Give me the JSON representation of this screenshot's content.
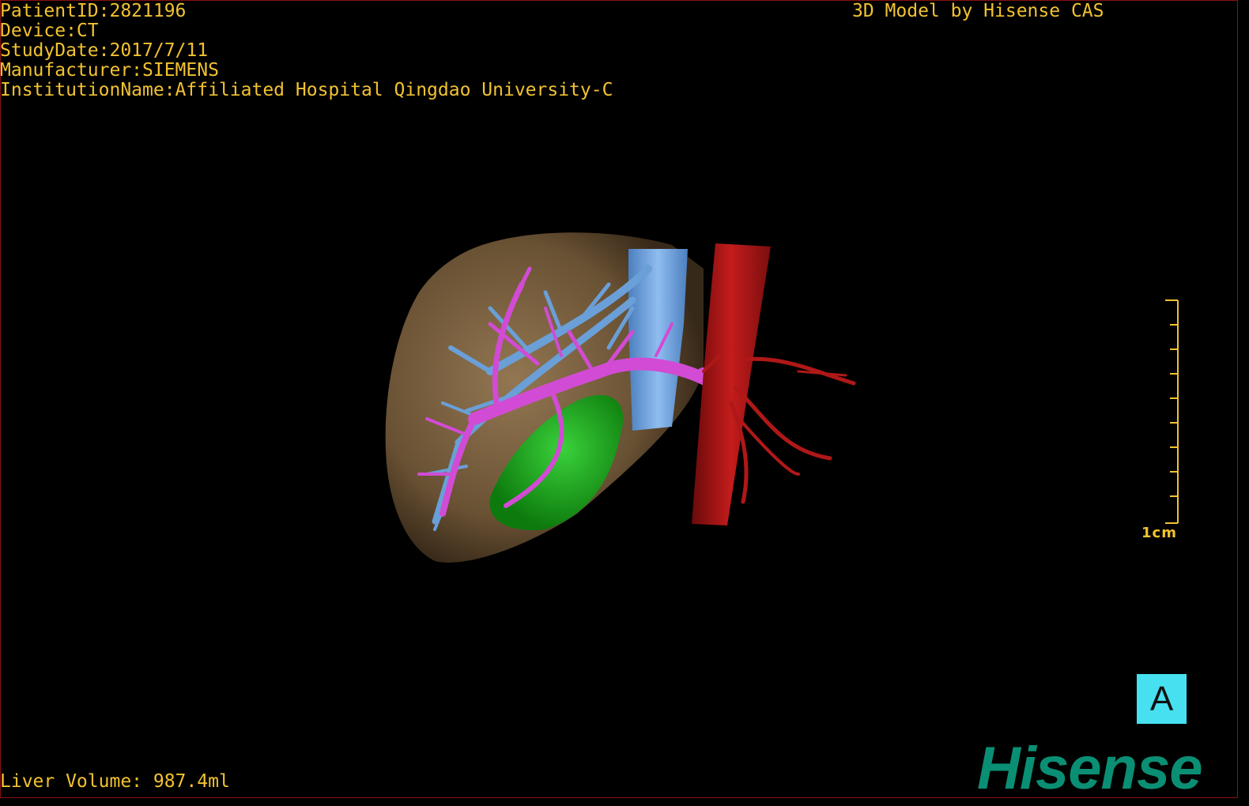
{
  "header": {
    "patient_id": "PatientID:2821196",
    "device": "Device:CT",
    "study_date": "StudyDate:2017/7/11",
    "manufacturer": "Manufacturer:SIEMENS",
    "institution": "InstitutionName:Affiliated Hospital Qingdao University-C"
  },
  "credit": "3D Model by Hisense CAS",
  "footer": {
    "liver_volume": "Liver Volume: 987.4ml"
  },
  "scale_bar": {
    "label": "1cm"
  },
  "orientation_marker": {
    "label": "A"
  },
  "logo": {
    "text": "Hisense"
  },
  "colors": {
    "overlay_text": "#f2c230",
    "liver": "#8a6e4b",
    "hepatic_vein": "#6a9fd8",
    "portal_vein": "#d24bd4",
    "gallbladder": "#1fa31f",
    "aorta": "#b01818",
    "orientation_bg": "#46e0f0",
    "logo": "#0a8f74"
  }
}
